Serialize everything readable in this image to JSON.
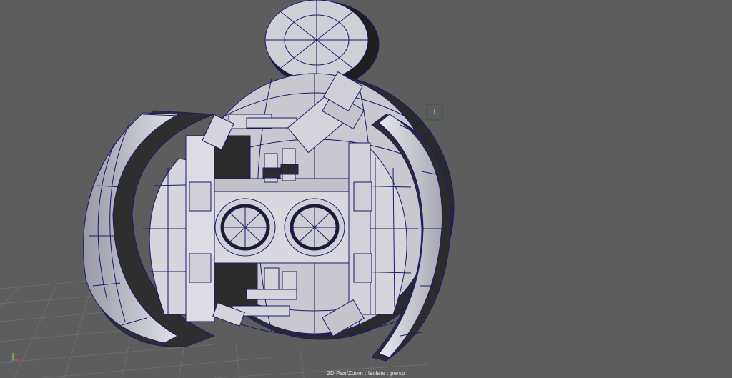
{
  "viewport": {
    "hud_text": "2D Pan/Zoom : Isolate : persp",
    "background": "#5d5d5d",
    "wire_color": "#1a1a6e",
    "surface_color": "#c9c9cf"
  },
  "axis_gizmo": {
    "x_color": "#d84a4a",
    "y_color": "#6ec04f",
    "z_color": "#4a7ed8"
  }
}
